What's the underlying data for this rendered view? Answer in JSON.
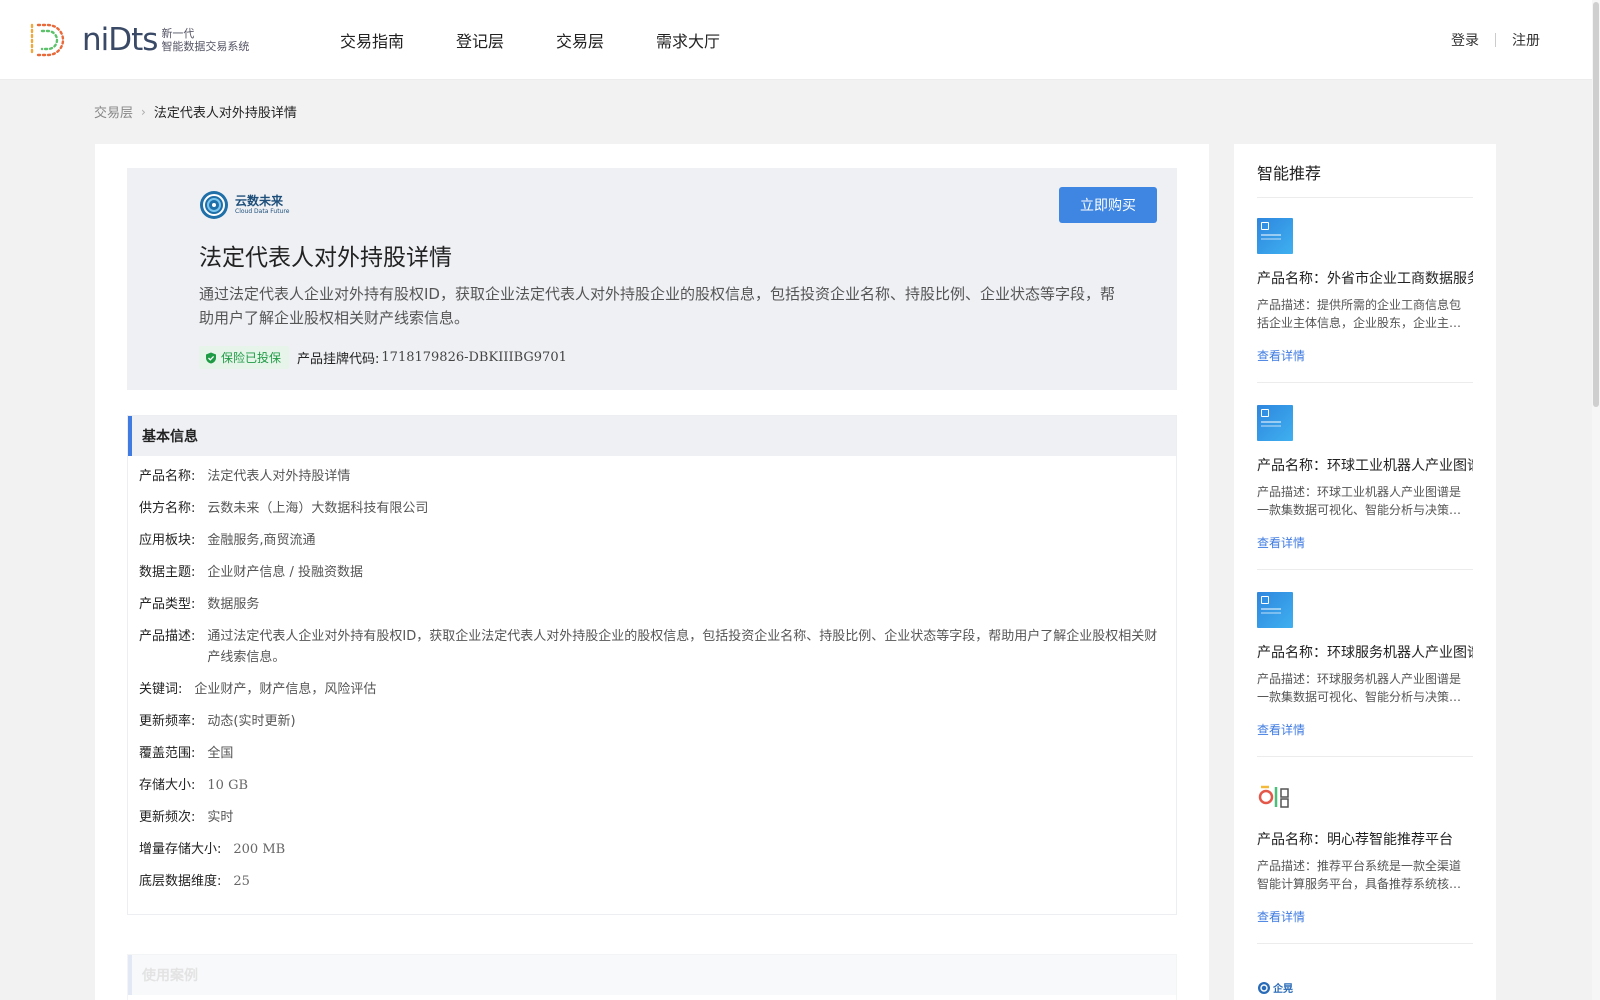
{
  "header": {
    "logo_word": "niDts",
    "logo_tag_line1": "新一代",
    "logo_tag_line2": "智能数据交易系统",
    "nav": [
      "交易指南",
      "登记层",
      "交易层",
      "需求大厅"
    ],
    "login": "登录",
    "register": "注册"
  },
  "breadcrumb": {
    "parent": "交易层",
    "current": "法定代表人对外持股详情"
  },
  "product": {
    "brand_cn": "云数未来",
    "brand_en": "Cloud Data Future",
    "title": "法定代表人对外持股详情",
    "description": "通过法定代表人企业对外持有股权ID，获取企业法定代表人对外持股企业的股权信息，包括投资企业名称、持股比例、企业状态等字段，帮助用户了解企业股权相关财产线索信息。",
    "insurance_badge": "保险已投保",
    "code_label": "产品挂牌代码:",
    "code_value": "1718179826-DBKIIIBG9701",
    "buy_label": "立即购买"
  },
  "basic_info": {
    "heading": "基本信息",
    "rows": [
      {
        "k": "产品名称:",
        "v": "法定代表人对外持股详情"
      },
      {
        "k": "供方名称:",
        "v": "云数未来（上海）大数据科技有限公司"
      },
      {
        "k": "应用板块:",
        "v": "金融服务,商贸流通"
      },
      {
        "k": "数据主题:",
        "v": "企业财产信息 / 投融资数据"
      },
      {
        "k": "产品类型:",
        "v": "数据服务"
      },
      {
        "k": "产品描述:",
        "v": "通过法定代表人企业对外持有股权ID，获取企业法定代表人对外持股企业的股权信息，包括投资企业名称、持股比例、企业状态等字段，帮助用户了解企业股权相关财产线索信息。"
      },
      {
        "k": "关键词:",
        "v": "企业财产，财产信息，风险评估"
      },
      {
        "k": "更新频率:",
        "v": "动态(实时更新)"
      },
      {
        "k": "覆盖范围:",
        "v": "全国"
      },
      {
        "k": "存储大小:",
        "v": "10 GB"
      },
      {
        "k": "更新频次:",
        "v": "实时"
      },
      {
        "k": "增量存储大小:",
        "v": "200 MB"
      },
      {
        "k": "底层数据维度:",
        "v": "25"
      }
    ]
  },
  "next_section_heading": "使用案例",
  "side": {
    "title": "智能推荐",
    "items": [
      {
        "name": "产品名称：外省市企业工商数据服务",
        "desc": "产品描述：提供所需的企业工商信息包括企业主体信息，企业股东，企业主要人员等信息",
        "link": "查看详情"
      },
      {
        "name": "产品名称：环球工业机器人产业图谱",
        "desc": "产品描述：环球工业机器人产业图谱是一款集数据可视化、智能分析与决策支持于一体的产品",
        "link": "查看详情"
      },
      {
        "name": "产品名称：环球服务机器人产业图谱",
        "desc": "产品描述：环球服务机器人产业图谱是一款集数据可视化、智能分析与决策支持于一体的产品",
        "link": "查看详情"
      },
      {
        "name": "产品名称：明心荐智能推荐平台",
        "desc": "产品描述：推荐平台系统是一款全渠道智能计算服务平台，具备推荐系统核心能力",
        "link": "查看详情"
      }
    ],
    "last_brand": "企晃"
  }
}
